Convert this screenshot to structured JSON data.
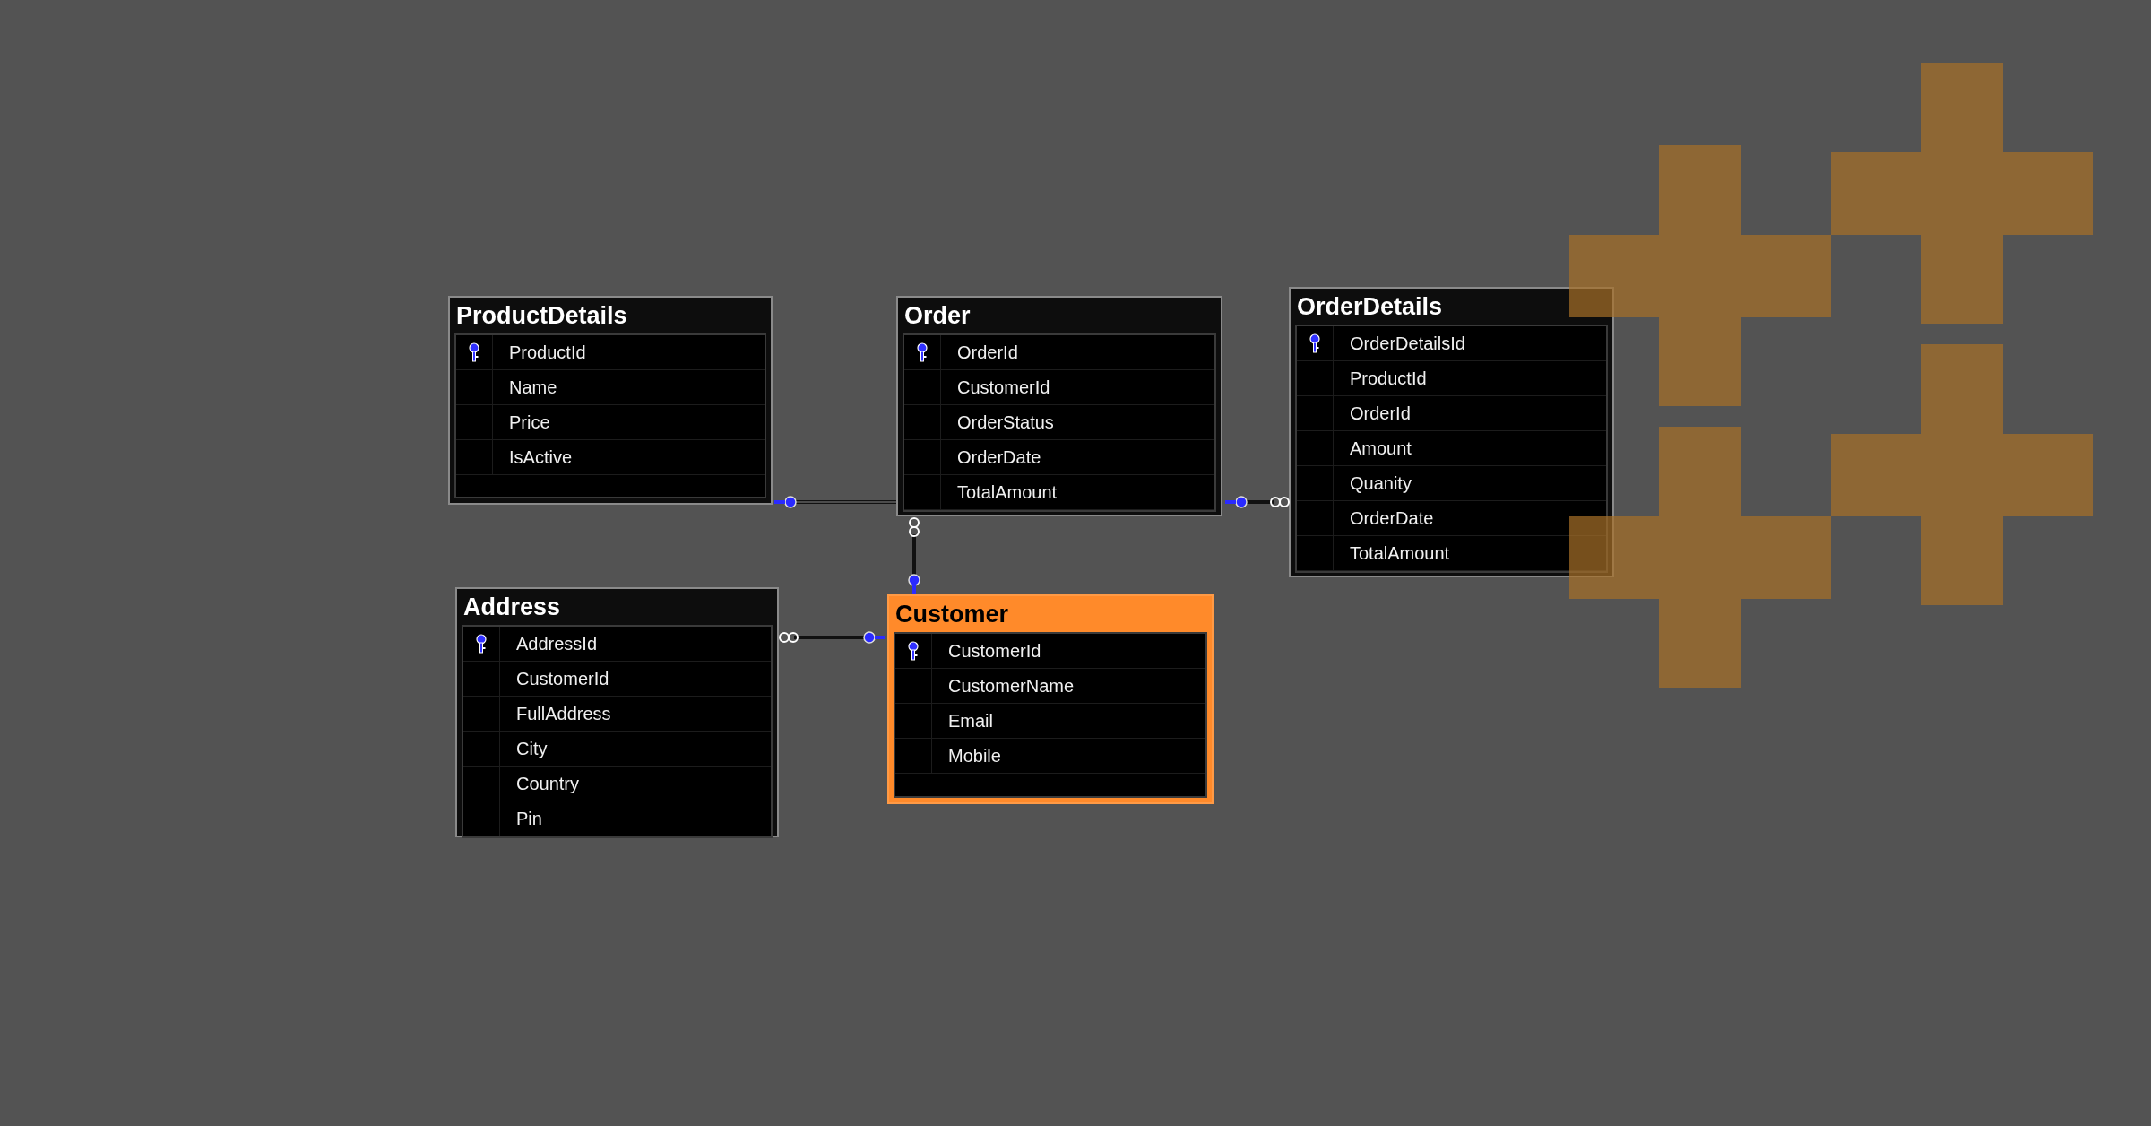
{
  "diagram": {
    "tables": [
      {
        "name": "ProductDetails",
        "selected": false,
        "columns": [
          {
            "name": "ProductId",
            "primary_key": true
          },
          {
            "name": "Name",
            "primary_key": false
          },
          {
            "name": "Price",
            "primary_key": false
          },
          {
            "name": "IsActive",
            "primary_key": false
          }
        ]
      },
      {
        "name": "Order",
        "selected": false,
        "columns": [
          {
            "name": "OrderId",
            "primary_key": true
          },
          {
            "name": "CustomerId",
            "primary_key": false
          },
          {
            "name": "OrderStatus",
            "primary_key": false
          },
          {
            "name": "OrderDate",
            "primary_key": false
          },
          {
            "name": "TotalAmount",
            "primary_key": false
          }
        ]
      },
      {
        "name": "OrderDetails",
        "selected": false,
        "columns": [
          {
            "name": "OrderDetailsId",
            "primary_key": true
          },
          {
            "name": "ProductId",
            "primary_key": false
          },
          {
            "name": "OrderId",
            "primary_key": false
          },
          {
            "name": "Amount",
            "primary_key": false
          },
          {
            "name": "Quanity",
            "primary_key": false
          },
          {
            "name": "OrderDate",
            "primary_key": false
          },
          {
            "name": "TotalAmount",
            "primary_key": false
          }
        ]
      },
      {
        "name": "Address",
        "selected": false,
        "columns": [
          {
            "name": "AddressId",
            "primary_key": true
          },
          {
            "name": "CustomerId",
            "primary_key": false
          },
          {
            "name": "FullAddress",
            "primary_key": false
          },
          {
            "name": "City",
            "primary_key": false
          },
          {
            "name": "Country",
            "primary_key": false
          },
          {
            "name": "Pin",
            "primary_key": false
          }
        ]
      },
      {
        "name": "Customer",
        "selected": true,
        "columns": [
          {
            "name": "CustomerId",
            "primary_key": true
          },
          {
            "name": "CustomerName",
            "primary_key": false
          },
          {
            "name": "Email",
            "primary_key": false
          },
          {
            "name": "Mobile",
            "primary_key": false
          }
        ]
      }
    ]
  }
}
